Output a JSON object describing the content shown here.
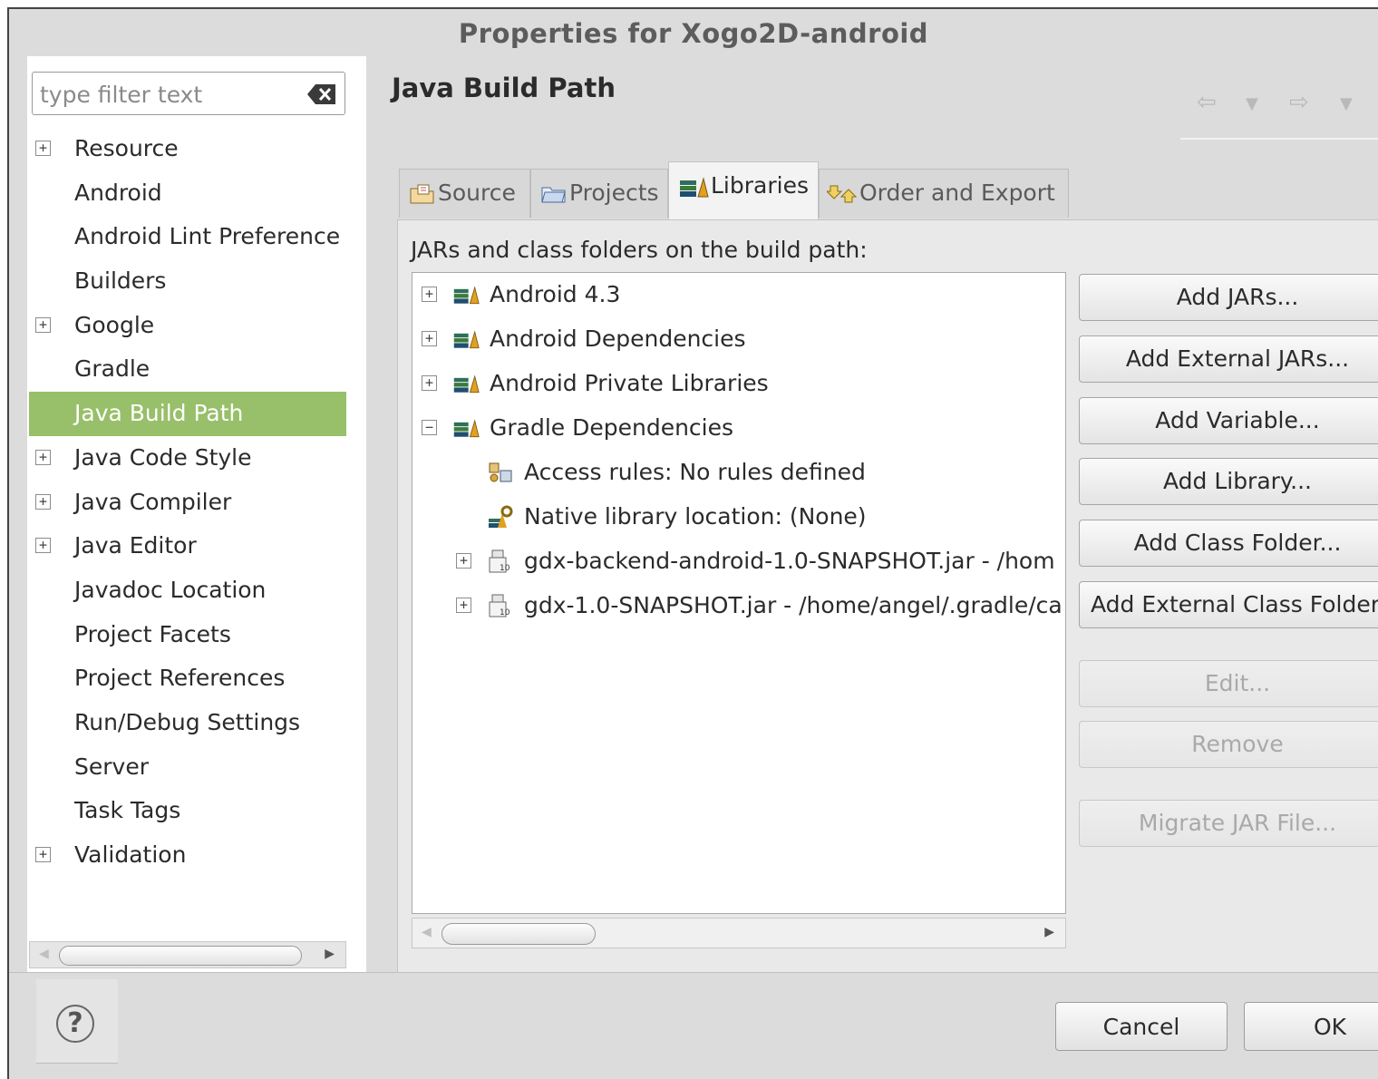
{
  "window": {
    "title": "Properties for Xogo2D-android"
  },
  "filter": {
    "placeholder": "type filter text"
  },
  "sidebar": {
    "items": [
      {
        "label": "Resource",
        "expandable": true,
        "symbol": "+"
      },
      {
        "label": "Android",
        "expandable": false
      },
      {
        "label": "Android Lint Preference",
        "expandable": false
      },
      {
        "label": "Builders",
        "expandable": false
      },
      {
        "label": "Google",
        "expandable": true,
        "symbol": "+"
      },
      {
        "label": "Gradle",
        "expandable": false
      },
      {
        "label": "Java Build Path",
        "expandable": false,
        "selected": true
      },
      {
        "label": "Java Code Style",
        "expandable": true,
        "symbol": "+"
      },
      {
        "label": "Java Compiler",
        "expandable": true,
        "symbol": "+"
      },
      {
        "label": "Java Editor",
        "expandable": true,
        "symbol": "+"
      },
      {
        "label": "Javadoc Location",
        "expandable": false
      },
      {
        "label": "Project Facets",
        "expandable": false
      },
      {
        "label": "Project References",
        "expandable": false
      },
      {
        "label": "Run/Debug Settings",
        "expandable": false
      },
      {
        "label": "Server",
        "expandable": false
      },
      {
        "label": "Task Tags",
        "expandable": false
      },
      {
        "label": "Validation",
        "expandable": true,
        "symbol": "+"
      }
    ]
  },
  "page": {
    "title": "Java Build Path"
  },
  "tabs": [
    {
      "label": "Source",
      "icon": "source-folder-icon"
    },
    {
      "label": "Projects",
      "icon": "projects-folder-icon"
    },
    {
      "label": "Libraries",
      "icon": "libraries-icon",
      "active": true
    },
    {
      "label": "Order and Export",
      "icon": "order-export-icon"
    }
  ],
  "libraries": {
    "label": "JARs and class folders on the build path:",
    "tree": [
      {
        "label": "Android 4.3",
        "symbol": "+",
        "icon": "library-icon"
      },
      {
        "label": "Android Dependencies",
        "symbol": "+",
        "icon": "library-icon"
      },
      {
        "label": "Android Private Libraries",
        "symbol": "+",
        "icon": "library-icon"
      },
      {
        "label": "Gradle Dependencies",
        "symbol": "−",
        "icon": "library-icon"
      },
      {
        "label": "Access rules: No rules defined",
        "icon": "access-rules-icon"
      },
      {
        "label": "Native library location: (None)",
        "icon": "native-library-icon"
      },
      {
        "label": "gdx-backend-android-1.0-SNAPSHOT.jar - /hom",
        "symbol": "+",
        "icon": "jar-file-icon"
      },
      {
        "label": "gdx-1.0-SNAPSHOT.jar - /home/angel/.gradle/ca",
        "symbol": "+",
        "icon": "jar-file-icon"
      }
    ],
    "buttons": [
      {
        "label": "Add JARs...",
        "enabled": true
      },
      {
        "label": "Add External JARs...",
        "enabled": true
      },
      {
        "label": "Add Variable...",
        "enabled": true
      },
      {
        "label": "Add Library...",
        "enabled": true
      },
      {
        "label": "Add Class Folder...",
        "enabled": true
      },
      {
        "label": "Add External Class Folder",
        "enabled": true
      },
      {
        "label": "Edit...",
        "enabled": false
      },
      {
        "label": "Remove",
        "enabled": false
      },
      {
        "label": "Migrate JAR File...",
        "enabled": false
      }
    ]
  },
  "footer": {
    "help_symbol": "?",
    "cancel_label": "Cancel",
    "ok_label": "OK"
  },
  "colors": {
    "selection": "#98bf6a",
    "dialog_bg": "#dcdcdc"
  }
}
